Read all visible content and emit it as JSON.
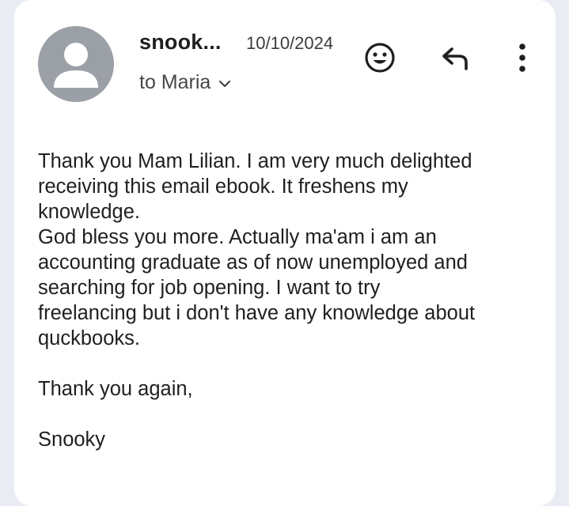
{
  "message": {
    "sender_name": "snook...",
    "date": "10/10/2024",
    "recipient": "to Maria",
    "icons": {
      "avatar": "person-avatar-icon",
      "recipient_toggle": "chevron-down-icon",
      "emoji": "add-reaction-emoji-icon",
      "reply": "reply-icon",
      "more": "more-vertical-icon"
    },
    "body": {
      "paragraph_1": "Thank you Mam Lilian. I am very much delighted\nreceiving this email ebook. It  freshens my\nknowledge.\nGod bless you  more. Actually ma'am i am an\naccounting graduate as of now unemployed and\nsearching for job opening. I want to try\nfreelancing but i  don't have any knowledge about\nquckbooks.",
      "closing": "Thank you again,",
      "signature": "Snooky"
    }
  },
  "colors": {
    "background": "#e9edf3",
    "card": "#ffffff",
    "avatar": "#9aa0a6",
    "text": "#1f1f1f"
  }
}
